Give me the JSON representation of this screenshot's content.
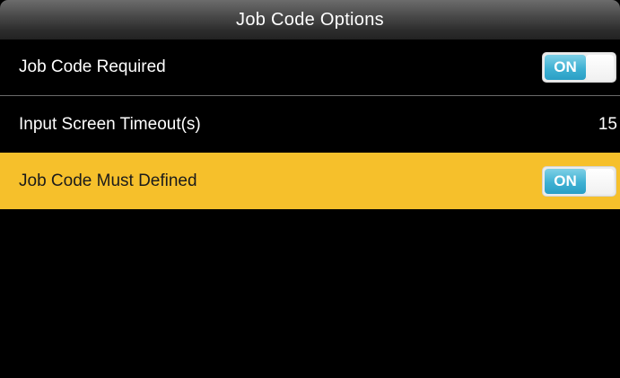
{
  "header": {
    "title": "Job Code Options"
  },
  "rows": [
    {
      "label": "Job Code Required",
      "toggle": "ON",
      "selected": false
    },
    {
      "label": "Input Screen Timeout(s)",
      "value": "15",
      "selected": false
    },
    {
      "label": "Job Code Must Defined",
      "toggle": "ON",
      "selected": true
    }
  ],
  "colors": {
    "background": "#000000",
    "selected_row": "#f6c02b",
    "toggle_on": "#3fb1d3",
    "divider": "#6a6a6a"
  }
}
